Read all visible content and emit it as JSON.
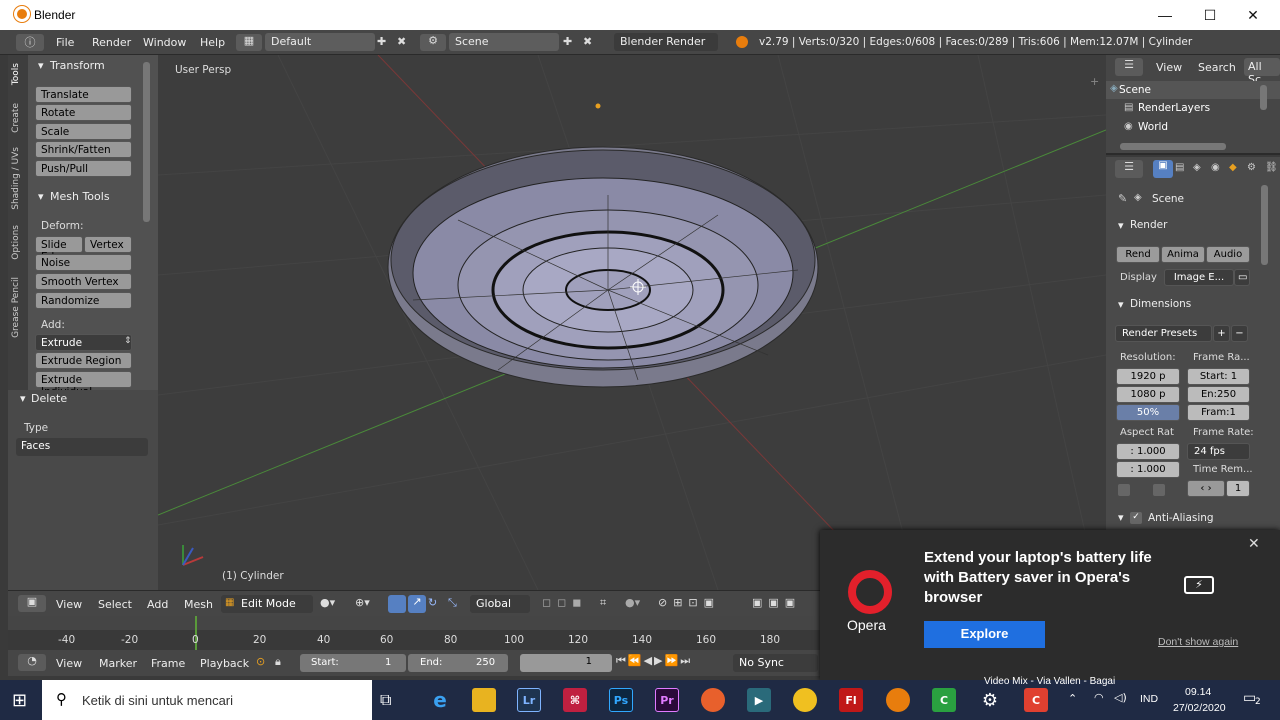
{
  "window": {
    "title": "Blender",
    "minimize": "—",
    "maximize": "☐",
    "close": "✕"
  },
  "infobar": {
    "menus": [
      "File",
      "Render",
      "Window",
      "Help"
    ],
    "layout": "Default",
    "scene": "Scene",
    "engine": "Blender Render",
    "stats": "v2.79 | Verts:0/320 | Edges:0/608 | Faces:0/289 | Tris:606 | Mem:12.07M | Cylinder"
  },
  "tool_tabs": [
    "Tools",
    "Create",
    "Shading / UVs",
    "Options",
    "Grease Pencil"
  ],
  "toolshelf": {
    "transform_title": "Transform",
    "transform_buttons": [
      "Translate",
      "Rotate",
      "Scale",
      "Shrink/Fatten",
      "Push/Pull"
    ],
    "mesh_tools_title": "Mesh Tools",
    "deform_label": "Deform:",
    "slide_edge": "Slide Ed",
    "vertex": "Vertex",
    "deform_buttons": [
      "Noise",
      "Smooth Vertex",
      "Randomize"
    ],
    "add_label": "Add:",
    "extrude": "Extrude",
    "add_buttons": [
      "Extrude Region",
      "Extrude Individual"
    ]
  },
  "operator": {
    "title": "Delete",
    "type_label": "Type",
    "type_value": "Faces"
  },
  "viewport": {
    "view_name": "User Persp",
    "object_name": "(1) Cylinder"
  },
  "outliner": {
    "view": "View",
    "search": "Search",
    "all_scenes": "All Sc",
    "items": [
      "Scene",
      "RenderLayers",
      "World"
    ]
  },
  "properties": {
    "scene_crumb": "Scene",
    "render_panel": "Render",
    "render_btns": [
      "Rend",
      "Anima",
      "Audio"
    ],
    "display_label": "Display",
    "display_value": "Image E...",
    "dimensions_panel": "Dimensions",
    "render_presets": "Render Presets",
    "resolution_label": "Resolution:",
    "frame_range_label": "Frame Ra...",
    "res_x": "1920 p",
    "res_y": "1080 p",
    "res_pct": "50%",
    "start": "Start: 1",
    "end": "En:250",
    "frame": "Fram:1",
    "aspect_label": "Aspect Rat",
    "frame_rate_label": "Frame Rate:",
    "aspect_x": ": 1.000",
    "aspect_y": ": 1.000",
    "fps": "24 fps",
    "time_remap": "Time Rem...",
    "time_value": "1",
    "anti_aliasing": "Anti-Aliasing"
  },
  "header3d": {
    "menus": [
      "View",
      "Select",
      "Add",
      "Mesh"
    ],
    "mode": "Edit Mode",
    "orientation": "Global"
  },
  "timeline": {
    "ticks": [
      "-40",
      "-20",
      "0",
      "20",
      "40",
      "60",
      "80",
      "100",
      "120",
      "140",
      "160",
      "180"
    ],
    "menus": [
      "View",
      "Marker",
      "Frame",
      "Playback"
    ],
    "start_label": "Start:",
    "start_value": "1",
    "end_label": "End:",
    "end_value": "250",
    "current": "1",
    "sync": "No Sync"
  },
  "opera_popup": {
    "brand": "Opera",
    "headline": "Extend your laptop's battery life with Battery saver in Opera's browser",
    "cta": "Explore",
    "dismiss": "Don't show again"
  },
  "taskbar": {
    "search_placeholder": "Ketik di sini untuk mencari",
    "preview_text": "Video Mix - Via Vallen - Bagai",
    "lang": "IND",
    "time": "09.14",
    "date": "27/02/2020",
    "notifications": "2"
  },
  "colors": {
    "accent_blue": "#5680c2",
    "opera_red": "#e3202b",
    "opera_button": "#1f6fe0"
  }
}
